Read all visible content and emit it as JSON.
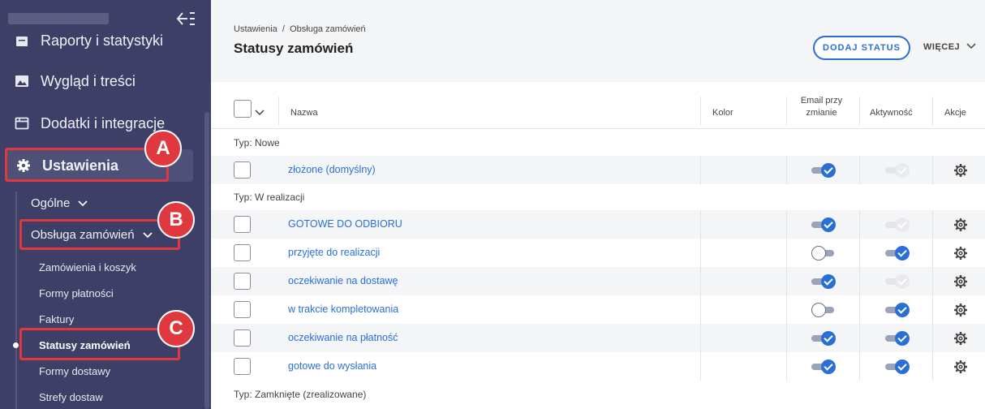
{
  "sidebar": {
    "nav": [
      {
        "label": "Raporty i statystyki",
        "icon": "report-icon"
      },
      {
        "label": "Wygląd i treści",
        "icon": "image-icon"
      },
      {
        "label": "Dodatki i integracje",
        "icon": "addons-icon"
      },
      {
        "label": "Ustawienia",
        "icon": "gear-icon"
      }
    ],
    "sub": {
      "general": "Ogólne",
      "orders": "Obsługa zamówień"
    },
    "subsub": [
      "Zamówienia i koszyk",
      "Formy płatności",
      "Faktury",
      "Statusy zamówień",
      "Formy dostawy",
      "Strefy dostaw"
    ]
  },
  "annotations": {
    "a": "A",
    "b": "B",
    "c": "C"
  },
  "header": {
    "breadcrumb": "Ustawienia  /  Obsługa zamówień",
    "title": "Statusy zamówień",
    "add_button": "DODAJ STATUS",
    "more_button": "WIĘCEJ"
  },
  "table": {
    "columns": {
      "name": "Nazwa",
      "color": "Kolor",
      "email_line1": "Email przy",
      "email_line2": "zmianie",
      "active": "Aktywność",
      "actions": "Akcje"
    },
    "groups": {
      "new": "Typ: Nowe",
      "in_progress": "Typ: W realizacji",
      "closed": "Typ: Zamknięte (zrealizowane)"
    },
    "rows": [
      {
        "name": "złożone (domyślny)",
        "email": "on",
        "active": "disabled"
      },
      {
        "name": "GOTOWE DO ODBIORU",
        "email": "on",
        "active": "disabled"
      },
      {
        "name": "przyjęte do realizacji",
        "email": "off",
        "active": "on"
      },
      {
        "name": "oczekiwanie na dostawę",
        "email": "on",
        "active": "disabled"
      },
      {
        "name": "w trakcie kompletowania",
        "email": "off",
        "active": "on"
      },
      {
        "name": "oczekiwanie na płatność",
        "email": "on",
        "active": "on"
      },
      {
        "name": "gotowe do wysłania",
        "email": "on",
        "active": "on"
      }
    ]
  },
  "colors": {
    "accent": "#2a6fd6",
    "sidebar": "#3d3f66",
    "highlight": "#e0383f"
  }
}
